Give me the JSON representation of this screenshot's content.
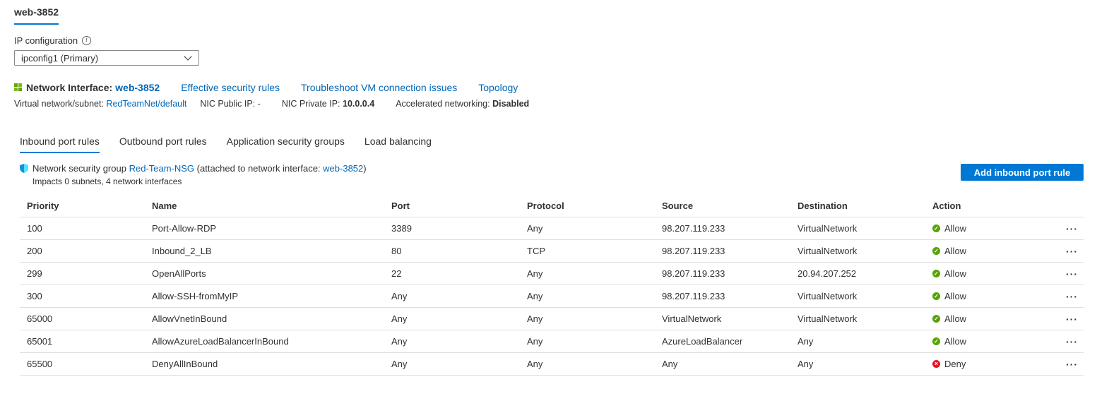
{
  "nic_tab": "web-3852",
  "ip_config": {
    "label": "IP configuration",
    "selected": "ipconfig1 (Primary)"
  },
  "nic": {
    "label": "Network Interface:",
    "name": "web-3852",
    "links": [
      "Effective security rules",
      "Troubleshoot VM connection issues",
      "Topology"
    ],
    "vnet_label": "Virtual network/subnet:",
    "vnet_value": "RedTeamNet/default",
    "public_ip_label": "NIC Public IP:",
    "public_ip_value": "-",
    "private_ip_label": "NIC Private IP:",
    "private_ip_value": "10.0.0.4",
    "accel_label": "Accelerated networking:",
    "accel_value": "Disabled"
  },
  "tabs": [
    "Inbound port rules",
    "Outbound port rules",
    "Application security groups",
    "Load balancing"
  ],
  "nsg": {
    "prefix": "Network security group",
    "name": "Red-Team-NSG",
    "attached_prefix": "(attached to network interface:",
    "attached_nic": "web-3852",
    "attached_suffix": ")",
    "impacts": "Impacts 0 subnets, 4 network interfaces"
  },
  "add_button": "Add inbound port rule",
  "table": {
    "headers": [
      "Priority",
      "Name",
      "Port",
      "Protocol",
      "Source",
      "Destination",
      "Action"
    ],
    "rows": [
      {
        "priority": "100",
        "name": "Port-Allow-RDP",
        "port": "3389",
        "protocol": "Any",
        "source": "98.207.119.233",
        "destination": "VirtualNetwork",
        "action": "Allow"
      },
      {
        "priority": "200",
        "name": "Inbound_2_LB",
        "port": "80",
        "protocol": "TCP",
        "source": "98.207.119.233",
        "destination": "VirtualNetwork",
        "action": "Allow"
      },
      {
        "priority": "299",
        "name": "OpenAllPorts",
        "port": "22",
        "protocol": "Any",
        "source": "98.207.119.233",
        "destination": "20.94.207.252",
        "action": "Allow"
      },
      {
        "priority": "300",
        "name": "Allow-SSH-fromMyIP",
        "port": "Any",
        "protocol": "Any",
        "source": "98.207.119.233",
        "destination": "VirtualNetwork",
        "action": "Allow"
      },
      {
        "priority": "65000",
        "name": "AllowVnetInBound",
        "port": "Any",
        "protocol": "Any",
        "source": "VirtualNetwork",
        "destination": "VirtualNetwork",
        "action": "Allow"
      },
      {
        "priority": "65001",
        "name": "AllowAzureLoadBalancerInBound",
        "port": "Any",
        "protocol": "Any",
        "source": "AzureLoadBalancer",
        "destination": "Any",
        "action": "Allow"
      },
      {
        "priority": "65500",
        "name": "DenyAllInBound",
        "port": "Any",
        "protocol": "Any",
        "source": "Any",
        "destination": "Any",
        "action": "Deny"
      }
    ],
    "row_menu": "···"
  },
  "icons": {
    "info": "info-icon",
    "chevron": "chevron-down-icon",
    "nic": "network-interface-icon",
    "shield": "shield-icon",
    "allow": "check-circle-icon",
    "deny": "error-circle-icon",
    "more": "more-icon"
  },
  "colors": {
    "accent": "#0078d4",
    "link": "#0067b8",
    "allow": "#57a300",
    "deny": "#e81123"
  }
}
